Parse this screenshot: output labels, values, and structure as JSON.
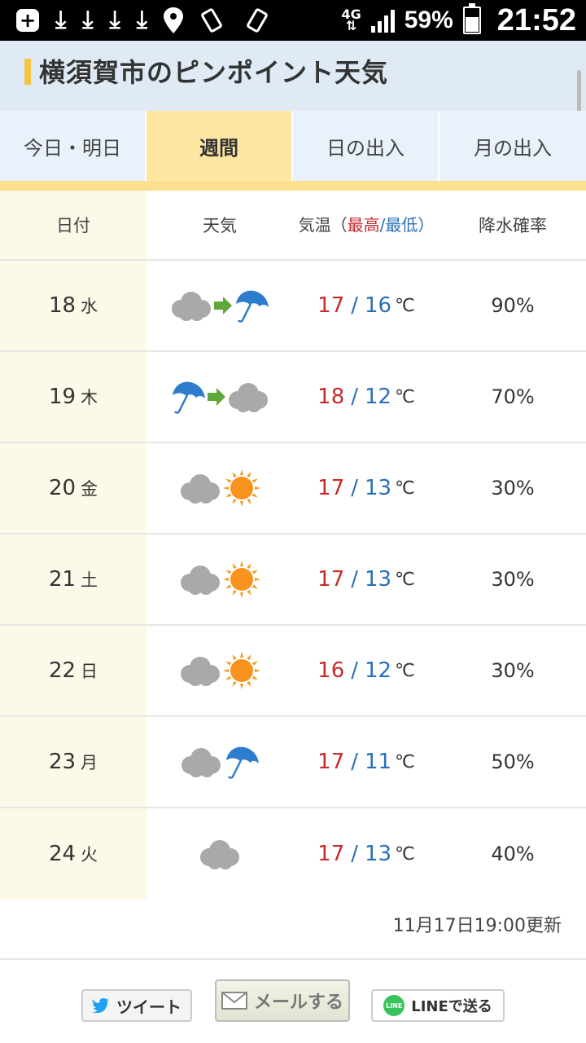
{
  "status_bar": {
    "battery": "59%",
    "time": "21:52",
    "network": "4G",
    "battery_level": 0.59
  },
  "header": {
    "title": "横須賀市のピンポイント天気"
  },
  "tabs": [
    {
      "label": "今日・明日"
    },
    {
      "label": "週間"
    },
    {
      "label": "日の出入"
    },
    {
      "label": "月の出入"
    }
  ],
  "table": {
    "head": {
      "date": "日付",
      "weather": "天気",
      "temp_prefix": "気温（",
      "temp_hi": "最高",
      "temp_slash": "/",
      "temp_lo": "最低",
      "temp_suffix": "）",
      "rain": "降水確率"
    },
    "rows": [
      {
        "date": "18",
        "day": "水",
        "icons": [
          "cloud-icon",
          "arrow-icon",
          "umbrella-icon"
        ],
        "hi": "17",
        "lo": "16",
        "unit": "℃",
        "rain": "90%"
      },
      {
        "date": "19",
        "day": "木",
        "icons": [
          "umbrella-icon",
          "arrow-icon",
          "cloud-icon"
        ],
        "hi": "18",
        "lo": "12",
        "unit": "℃",
        "rain": "70%"
      },
      {
        "date": "20",
        "day": "金",
        "icons": [
          "cloud-icon",
          "sun-icon"
        ],
        "hi": "17",
        "lo": "13",
        "unit": "℃",
        "rain": "30%"
      },
      {
        "date": "21",
        "day": "土",
        "icons": [
          "cloud-icon",
          "sun-icon"
        ],
        "hi": "17",
        "lo": "13",
        "unit": "℃",
        "rain": "30%"
      },
      {
        "date": "22",
        "day": "日",
        "icons": [
          "cloud-icon",
          "sun-icon"
        ],
        "hi": "16",
        "lo": "12",
        "unit": "℃",
        "rain": "30%"
      },
      {
        "date": "23",
        "day": "月",
        "icons": [
          "cloud-icon",
          "umbrella-icon"
        ],
        "hi": "17",
        "lo": "11",
        "unit": "℃",
        "rain": "50%"
      },
      {
        "date": "24",
        "day": "火",
        "icons": [
          "cloud-icon"
        ],
        "hi": "17",
        "lo": "13",
        "unit": "℃",
        "rain": "40%"
      }
    ]
  },
  "updated": "11月17日19:00更新",
  "share": {
    "tweet": "ツイート",
    "mail": "メールする",
    "line": "LINEで送る",
    "line_logo": "LINE"
  },
  "colors": {
    "high": "#c72b2b",
    "low": "#2a6fb6",
    "active_tab": "#fde7a3"
  }
}
